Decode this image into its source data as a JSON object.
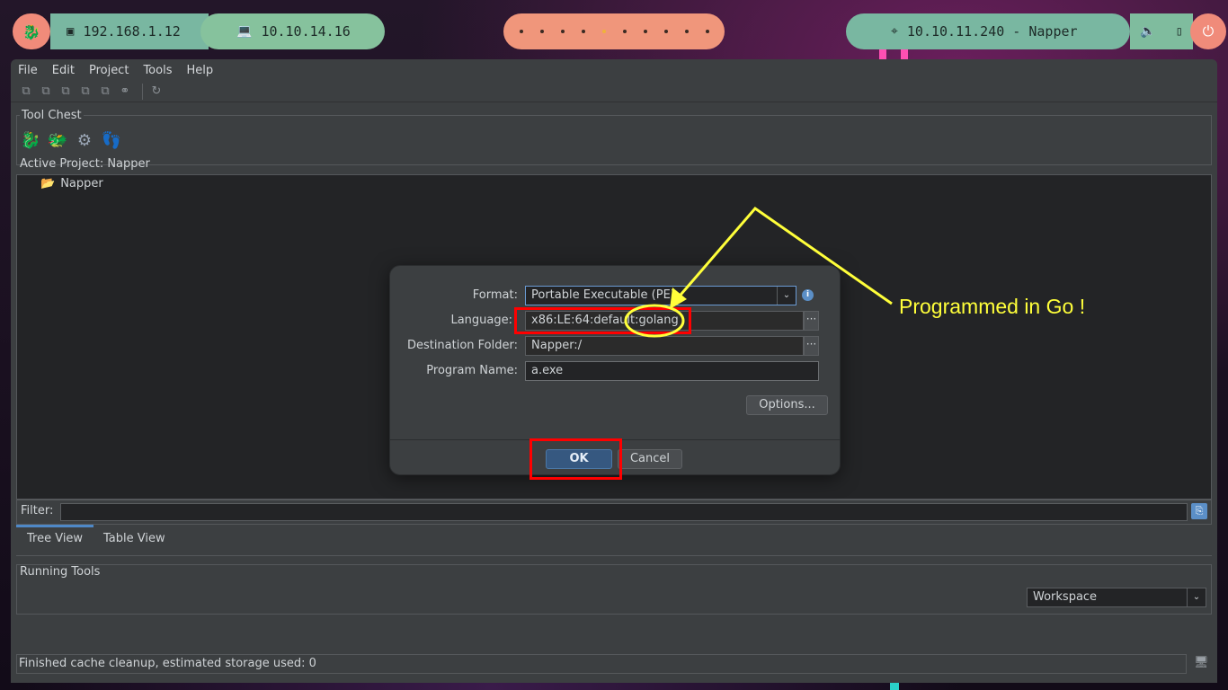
{
  "topbar": {
    "ip_local": "192.168.1.12",
    "ip_vpn": "10.10.14.16",
    "workspaces": 10,
    "active_workspace": 5,
    "target": "10.10.11.240 - Napper"
  },
  "menu": {
    "file": "File",
    "edit": "Edit",
    "project": "Project",
    "tools": "Tools",
    "help": "Help"
  },
  "tool_chest": {
    "title": "Tool Chest"
  },
  "project": {
    "title": "Active Project: Napper",
    "root_folder": "Napper"
  },
  "filter": {
    "label": "Filter:"
  },
  "tabs": {
    "tree_view": "Tree View",
    "table_view": "Table View"
  },
  "running_tools": {
    "title": "Running Tools",
    "workspace": "Workspace"
  },
  "status": {
    "message": "Finished cache cleanup, estimated storage used: 0"
  },
  "dialog": {
    "format_label": "Format:",
    "format_value": "Portable Executable (PE)",
    "language_label": "Language:",
    "language_value": "x86:LE:64:default:golang",
    "dest_label": "Destination Folder:",
    "dest_value": "Napper:/",
    "name_label": "Program Name:",
    "name_value": "a.exe",
    "options_label": "Options...",
    "ok_label": "OK",
    "cancel_label": "Cancel"
  },
  "annotation": {
    "text": "Programmed in Go !",
    "color": "#ffff3a",
    "box_color": "#ff0000"
  }
}
